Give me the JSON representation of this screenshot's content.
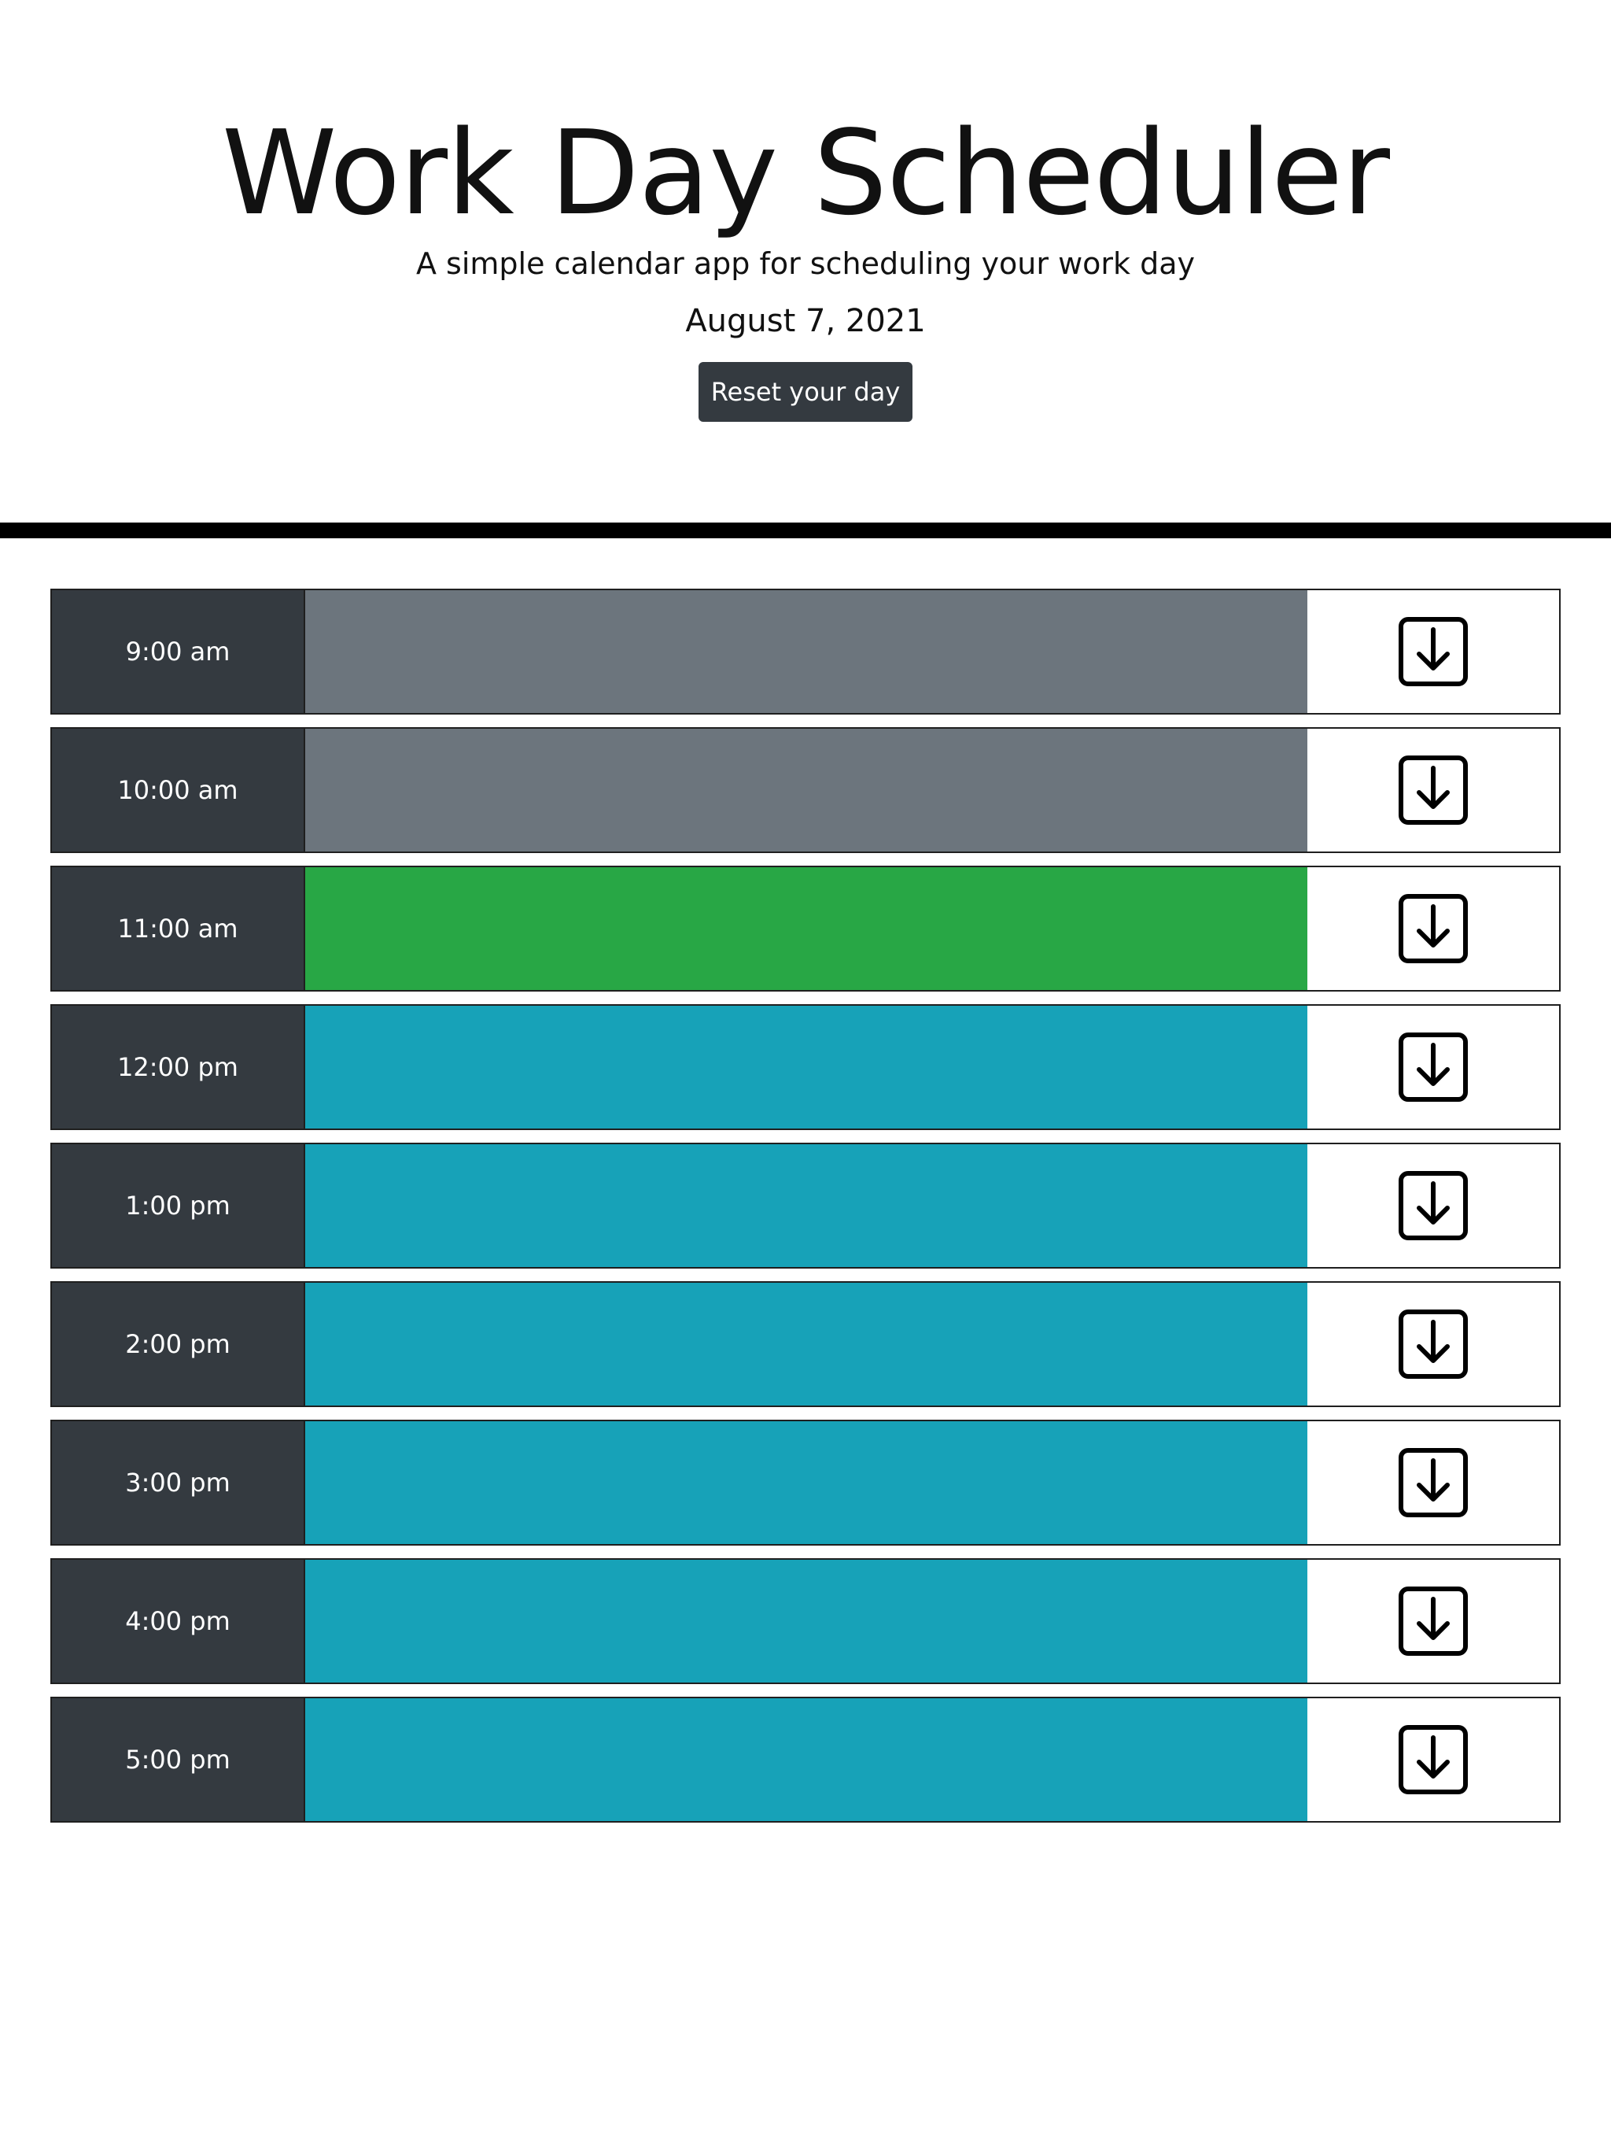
{
  "header": {
    "title": "Work Day Scheduler",
    "subtitle": "A simple calendar app for scheduling your work day",
    "current_date": "August 7, 2021",
    "reset_label": "Reset your day"
  },
  "status_colors": {
    "past": "#6c757d",
    "present": "#28a745",
    "future": "#17a2b8"
  },
  "time_blocks": [
    {
      "hour": "9:00 am",
      "status": "past",
      "text": "",
      "save_icon": "save-download-icon"
    },
    {
      "hour": "10:00 am",
      "status": "past",
      "text": "",
      "save_icon": "save-download-icon"
    },
    {
      "hour": "11:00 am",
      "status": "present",
      "text": "",
      "save_icon": "save-download-icon"
    },
    {
      "hour": "12:00 pm",
      "status": "future",
      "text": "",
      "save_icon": "save-download-icon"
    },
    {
      "hour": "1:00 pm",
      "status": "future",
      "text": "",
      "save_icon": "save-download-icon"
    },
    {
      "hour": "2:00 pm",
      "status": "future",
      "text": "",
      "save_icon": "save-download-icon"
    },
    {
      "hour": "3:00 pm",
      "status": "future",
      "text": "",
      "save_icon": "save-download-icon"
    },
    {
      "hour": "4:00 pm",
      "status": "future",
      "text": "",
      "save_icon": "save-download-icon"
    },
    {
      "hour": "5:00 pm",
      "status": "future",
      "text": "",
      "save_icon": "save-download-icon"
    }
  ]
}
